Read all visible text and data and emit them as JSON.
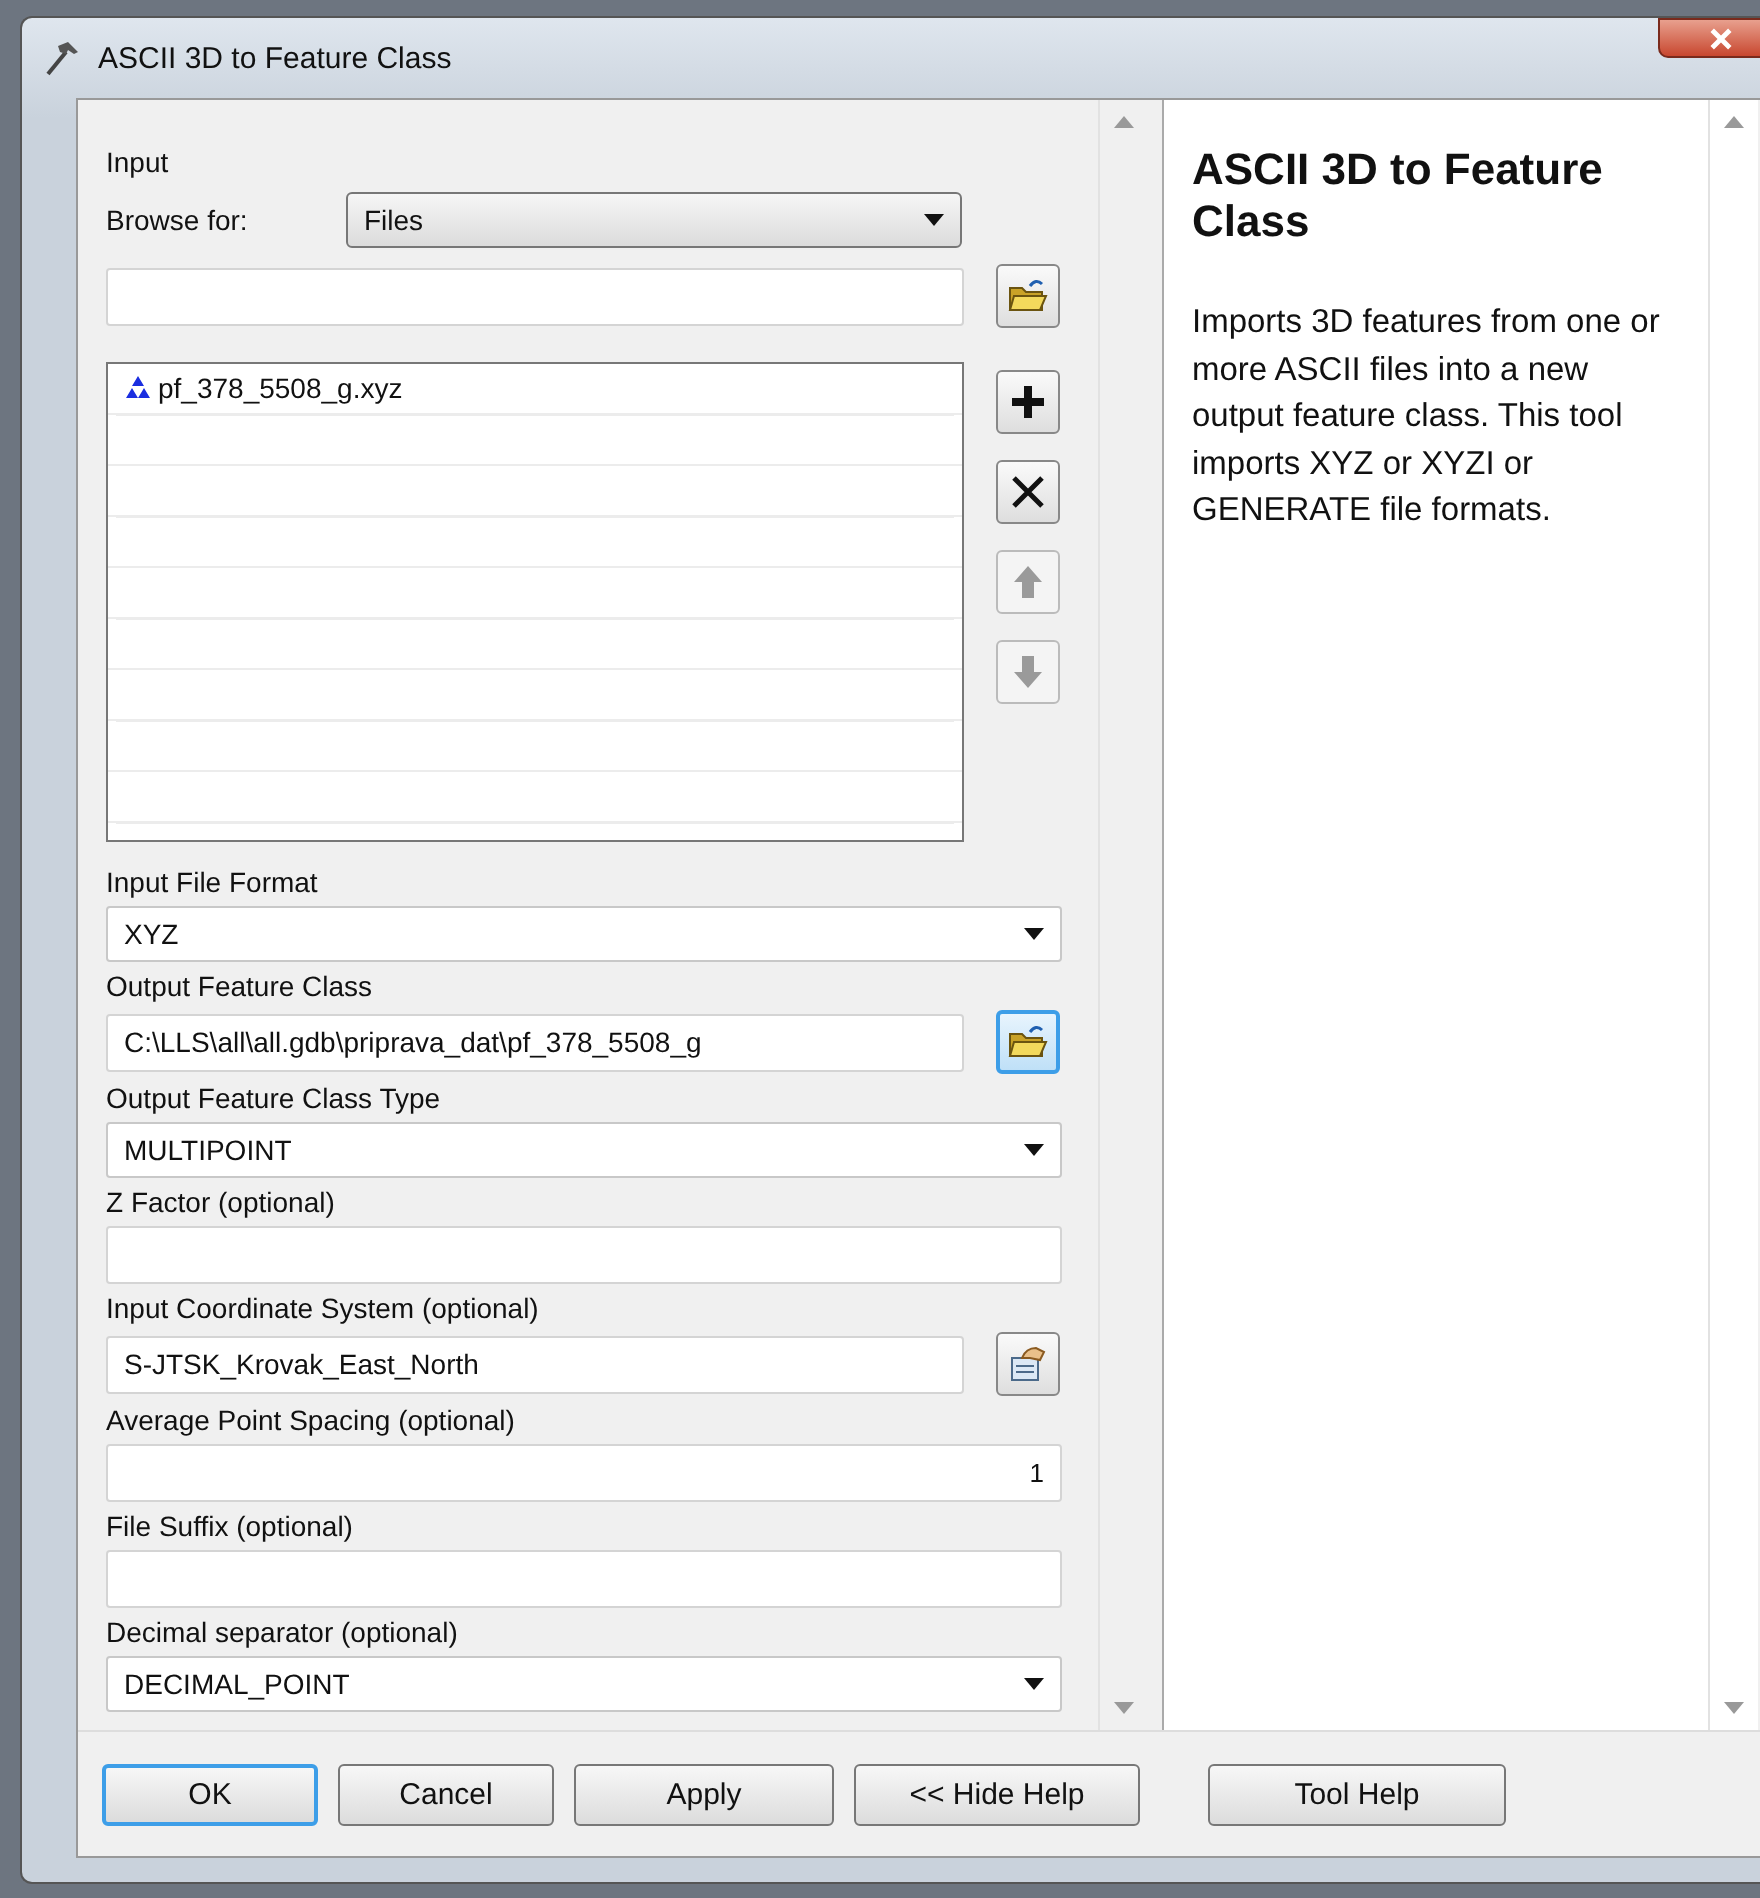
{
  "window": {
    "title": "ASCII 3D to Feature Class"
  },
  "input": {
    "label": "Input",
    "browse_for": {
      "label": "Browse for:",
      "value": "Files"
    },
    "files": [
      {
        "name": "pf_378_5508_g.xyz"
      }
    ],
    "list_tools": [
      {
        "kind": "add",
        "disabled": false
      },
      {
        "kind": "remove",
        "disabled": false
      },
      {
        "kind": "up",
        "disabled": true
      },
      {
        "kind": "down",
        "disabled": true
      }
    ]
  },
  "parameters": [
    {
      "kind": "dropdown",
      "label": "Input File Format",
      "value": "XYZ"
    },
    {
      "kind": "browse",
      "label": "Output Feature Class",
      "value": "C:\\LLS\\all\\all.gdb\\priprava_dat\\pf_378_5508_g",
      "focused": true
    },
    {
      "kind": "dropdown",
      "label": "Output Feature Class Type",
      "value": "MULTIPOINT"
    },
    {
      "kind": "text",
      "label": "Z Factor (optional)"
    },
    {
      "kind": "properties",
      "label": "Input Coordinate System (optional)",
      "value": "S-JTSK_Krovak_East_North",
      "focused": false
    },
    {
      "kind": "number",
      "label": "Average Point Spacing (optional)",
      "value": "1"
    },
    {
      "kind": "text",
      "label": "File Suffix (optional)"
    },
    {
      "kind": "dropdown",
      "label": "Decimal separator (optional)",
      "value": "DECIMAL_POINT"
    }
  ],
  "help": {
    "title": "ASCII 3D to Feature Class",
    "body": "Imports 3D features from one or more ASCII files into a new output feature class. This tool imports XYZ or XYZI or GENERATE file formats."
  },
  "buttons": [
    {
      "label": "OK",
      "default": true
    },
    {
      "label": "Cancel",
      "default": false
    },
    {
      "label": "Apply",
      "default": false
    },
    {
      "label": "<< Hide Help",
      "default": false
    },
    {
      "label": "Tool Help",
      "default": false
    }
  ]
}
